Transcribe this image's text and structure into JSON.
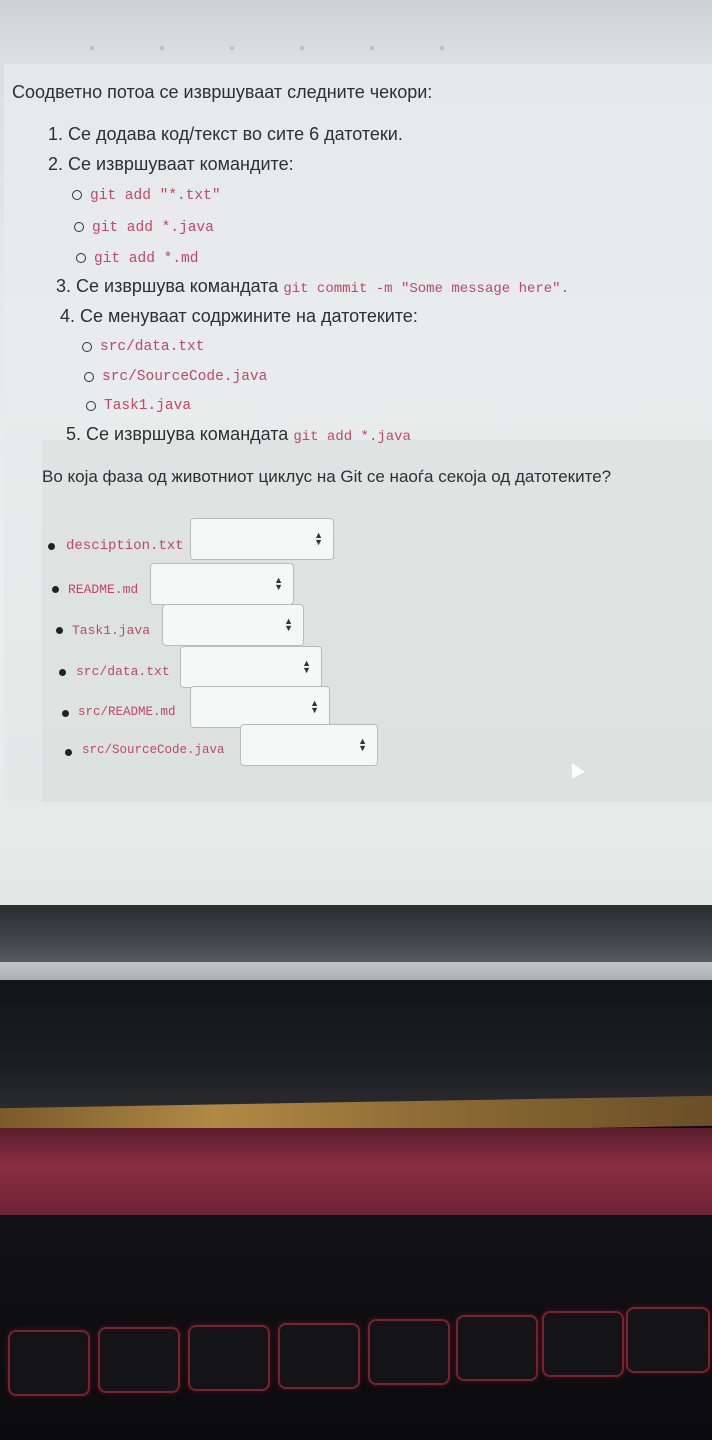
{
  "intro": "Соодветно потоа се извршуваат следните чекори:",
  "steps": {
    "s1": "1. Се додава код/текст во сите 6 датотеки.",
    "s2": "2. Се извршуваат командите:",
    "s2_cmds": [
      "git add \"*.txt\"",
      "git add *.java",
      "git add *.md"
    ],
    "s3_prefix": "3. Се извршува командата",
    "s3_cmd": "git commit -m \"Some message here\".",
    "s4": "4. Се менуваат содржините на датотеките:",
    "s4_files": [
      "src/data.txt",
      "src/SourceCode.java",
      "Task1.java"
    ],
    "s5_prefix": "5. Се извршува командата",
    "s5_cmd": "git add *.java"
  },
  "question": "Во која фаза од животниот циклус на Git се наоѓа секоја од датотеките?",
  "answers": [
    {
      "file": "desciption.txt",
      "value": ""
    },
    {
      "file": "README.md",
      "value": ""
    },
    {
      "file": "Task1.java",
      "value": ""
    },
    {
      "file": "src/data.txt",
      "value": ""
    },
    {
      "file": "src/README.md",
      "value": ""
    },
    {
      "file": "src/SourceCode.java",
      "value": ""
    }
  ],
  "icons": {
    "select_arrows": "updown-arrows-icon",
    "cursor": "mouse-pointer-icon"
  },
  "colors": {
    "code": "#c0466a",
    "text": "#2c2f33"
  }
}
